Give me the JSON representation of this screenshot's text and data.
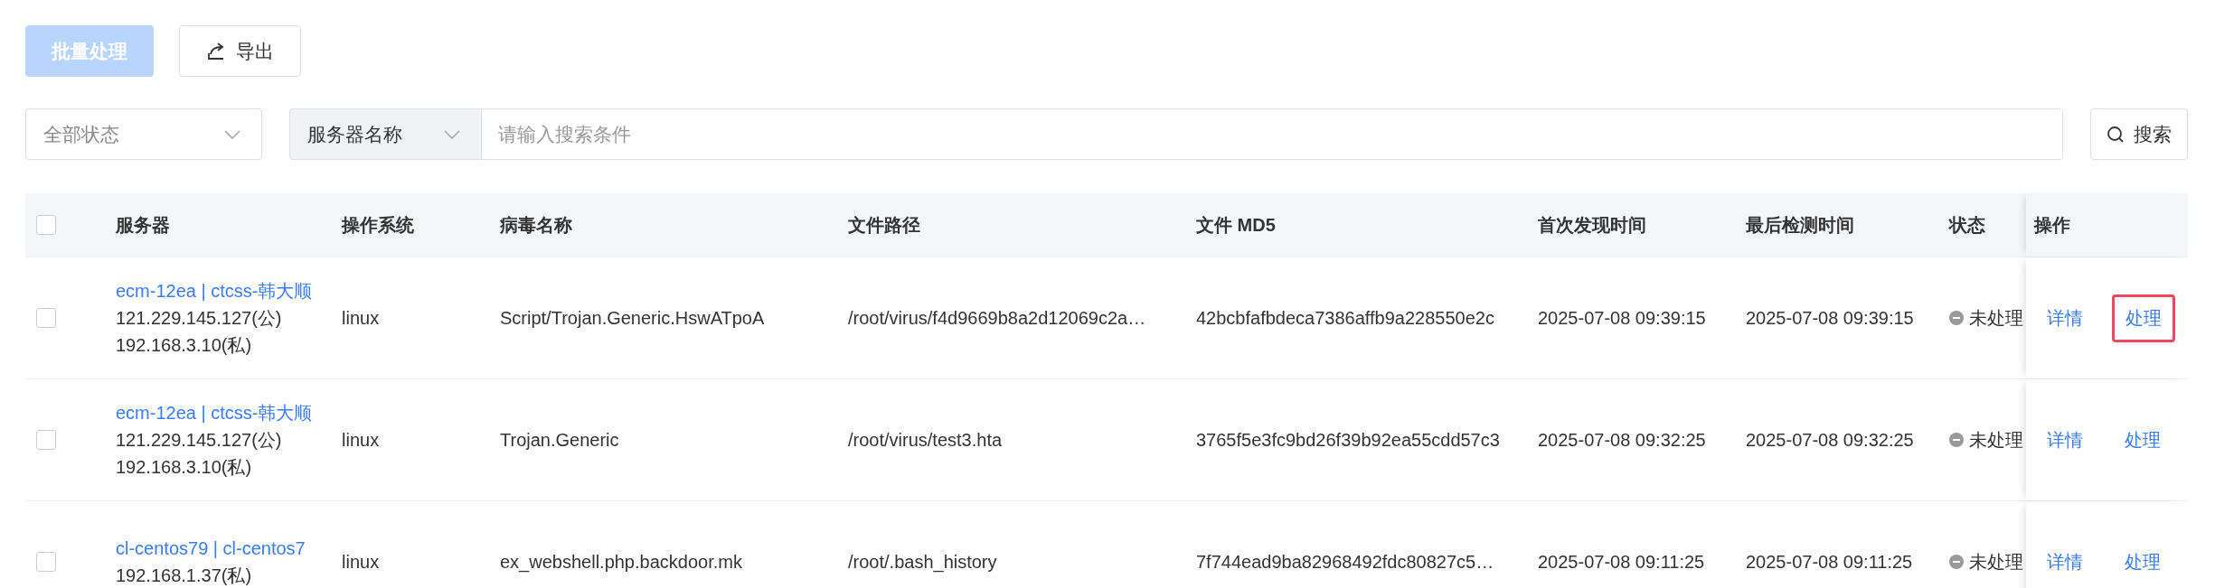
{
  "toolbar": {
    "batch_button": {
      "label": "批量处理",
      "disabled": true
    },
    "export_button": {
      "label": "导出"
    }
  },
  "filters": {
    "status_select": {
      "placeholder": "全部状态"
    },
    "field_select": {
      "value": "服务器名称"
    },
    "search": {
      "placeholder": "请输入搜索条件"
    },
    "search_button": {
      "label": "搜索"
    }
  },
  "table": {
    "select_all": {
      "checked": false
    },
    "columns": [
      "服务器",
      "操作系统",
      "病毒名称",
      "文件路径",
      "文件 MD5",
      "首次发现时间",
      "最后检测时间",
      "状态",
      "操作"
    ],
    "rows": [
      {
        "checked": false,
        "server_name": "ecm-12ea | ctcss-韩大顺",
        "ips": [
          "121.229.145.127(公)",
          "192.168.3.10(私)"
        ],
        "os": "linux",
        "virus": "Script/Trojan.Generic.HswATpoA",
        "path": "/root/virus/f4d9669b8a2d12069c2a…",
        "md5": "42bcbfafbdeca7386affb9a228550e2c",
        "first_seen": "2025-07-08 09:39:15",
        "last_checked": "2025-07-08 09:39:15",
        "status": "未处理",
        "actions": [
          {
            "label": "详情",
            "highlighted": false
          },
          {
            "label": "处理",
            "highlighted": true
          }
        ]
      },
      {
        "checked": false,
        "server_name": "ecm-12ea | ctcss-韩大顺",
        "ips": [
          "121.229.145.127(公)",
          "192.168.3.10(私)"
        ],
        "os": "linux",
        "virus": "Trojan.Generic",
        "path": "/root/virus/test3.hta",
        "md5": "3765f5e3fc9bd26f39b92ea55cdd57c3",
        "first_seen": "2025-07-08 09:32:25",
        "last_checked": "2025-07-08 09:32:25",
        "status": "未处理",
        "actions": [
          {
            "label": "详情",
            "highlighted": false
          },
          {
            "label": "处理",
            "highlighted": false
          }
        ]
      },
      {
        "checked": false,
        "server_name": "cl-centos79 | cl-centos7",
        "ips": [
          "192.168.1.37(私)"
        ],
        "os": "linux",
        "virus": "ex_webshell.php.backdoor.mk",
        "path": "/root/.bash_history",
        "md5": "7f744ead9ba82968492fdc80827c5…",
        "first_seen": "2025-07-08 09:11:25",
        "last_checked": "2025-07-08 09:11:25",
        "status": "未处理",
        "actions": [
          {
            "label": "详情",
            "highlighted": false
          },
          {
            "label": "处理",
            "highlighted": false
          }
        ]
      }
    ]
  }
}
